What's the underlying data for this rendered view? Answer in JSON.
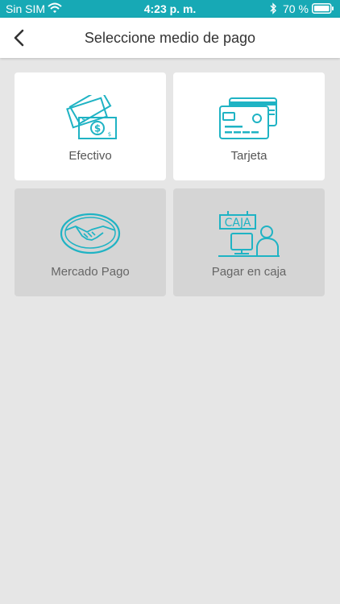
{
  "status_bar": {
    "carrier": "Sin SIM",
    "time": "4:23 p. m.",
    "battery_percent": "70 %",
    "battery_level": 0.7,
    "color": "#17a9b5"
  },
  "header": {
    "title": "Seleccione medio de pago",
    "back_icon": "chevron-left-icon"
  },
  "payment_methods": [
    {
      "label": "Efectivo",
      "icon": "cash-icon",
      "enabled": true
    },
    {
      "label": "Tarjeta",
      "icon": "credit-card-icon",
      "enabled": true
    },
    {
      "label": "Mercado Pago",
      "icon": "handshake-icon",
      "enabled": false
    },
    {
      "label": "Pagar en caja",
      "icon": "cashier-icon",
      "enabled": false,
      "icon_text": "CAJA"
    }
  ],
  "colors": {
    "accent": "#1fb3c4",
    "background": "#e6e6e6",
    "tile_enabled": "#ffffff",
    "tile_disabled": "#d5d5d5"
  }
}
